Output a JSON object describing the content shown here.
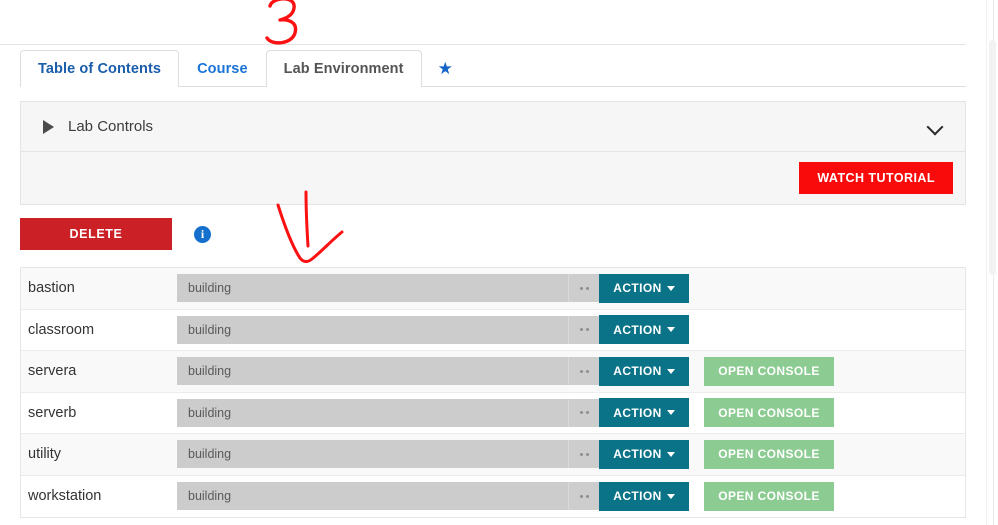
{
  "tabs": [
    {
      "label": "Table of Contents",
      "state": "active",
      "name": "tab-table-of-contents"
    },
    {
      "label": "Course",
      "state": "link",
      "name": "tab-course"
    },
    {
      "label": "Lab Environment",
      "state": "muted",
      "name": "tab-lab-environment"
    }
  ],
  "star_icon": "★",
  "lab_controls": {
    "title": "Lab Controls",
    "expand_triangle": "triangle-right-icon",
    "collapse_chevron": "chevron-down-icon",
    "watch_tutorial_label": "WATCH TUTORIAL"
  },
  "toolbar": {
    "delete_label": "DELETE",
    "info_label": "i"
  },
  "table": {
    "status_text": "building",
    "action_label": "ACTION",
    "console_label": "OPEN CONSOLE",
    "rows": [
      {
        "name": "bastion",
        "status": "building",
        "action": "ACTION",
        "console": null
      },
      {
        "name": "classroom",
        "status": "building",
        "action": "ACTION",
        "console": null
      },
      {
        "name": "servera",
        "status": "building",
        "action": "ACTION",
        "console": "OPEN CONSOLE"
      },
      {
        "name": "serverb",
        "status": "building",
        "action": "ACTION",
        "console": "OPEN CONSOLE"
      },
      {
        "name": "utility",
        "status": "building",
        "action": "ACTION",
        "console": "OPEN CONSOLE"
      },
      {
        "name": "workstation",
        "status": "building",
        "action": "ACTION",
        "console": "OPEN CONSOLE"
      }
    ]
  },
  "annotations": {
    "step_number": "3",
    "arrow": "hand-drawn-arrow"
  },
  "colors": {
    "tab_active_text": "#1a5dab",
    "tab_link": "#1a73d6",
    "watch_tutorial_bg": "#fa0b0b",
    "delete_bg": "#cc2027",
    "action_bg": "#0b7387",
    "console_bg": "#8ccc92",
    "info_bg": "#1470cc",
    "status_bar_bg": "#cccccc",
    "annotation_red": "#fb1111"
  }
}
